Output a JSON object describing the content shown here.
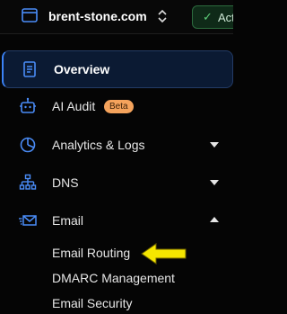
{
  "header": {
    "site_name": "brent-stone.com",
    "status_label": "Active",
    "site_icon": "browser-window-icon",
    "switcher_icon": "chevron-up-down-icon",
    "status_icon": "check-icon"
  },
  "nav": {
    "overview": {
      "label": "Overview",
      "icon": "document-icon"
    },
    "ai_audit": {
      "label": "AI Audit",
      "icon": "bot-icon",
      "badge": "Beta"
    },
    "analytics": {
      "label": "Analytics & Logs",
      "icon": "pie-chart-icon"
    },
    "dns": {
      "label": "DNS",
      "icon": "network-tree-icon"
    },
    "email": {
      "label": "Email",
      "icon": "envelope-icon",
      "children": [
        "Email Routing",
        "DMARC Management",
        "Email Security"
      ]
    }
  },
  "annotation": {
    "icon": "yellow-arrow-icon"
  },
  "colors": {
    "accent": "#3b82f6",
    "active_bg": "#0b1a33",
    "beta_badge": "#f5a35c",
    "status_green": "#5fcf7a",
    "arrow_yellow": "#f5e600"
  }
}
